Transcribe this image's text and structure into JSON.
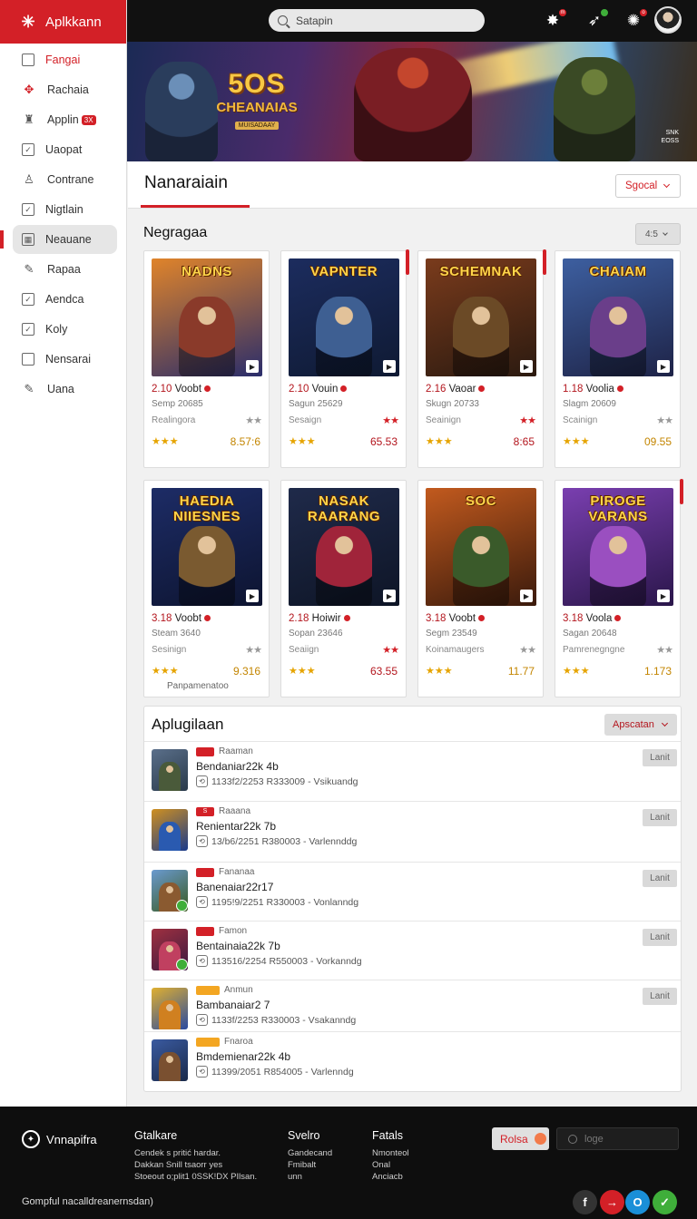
{
  "app": {
    "title": "Aplkkann"
  },
  "sidebar": {
    "items": [
      {
        "label": "Fangai",
        "icon": "square-icon",
        "active": false
      },
      {
        "label": "Rachaia",
        "icon": "gamepad-icon",
        "active": false
      },
      {
        "label": "Applin",
        "icon": "trophy-icon",
        "active": false,
        "badge": "3X"
      },
      {
        "label": "Uaopat",
        "icon": "checkbox-icon",
        "active": false
      },
      {
        "label": "Contrane",
        "icon": "user-icon",
        "active": false
      },
      {
        "label": "Nigtlain",
        "icon": "checkbox-icon",
        "active": false
      },
      {
        "label": "Neauane",
        "icon": "grid-icon",
        "active": true
      },
      {
        "label": "Rapaa",
        "icon": "pencil-icon",
        "active": false
      },
      {
        "label": "Aendca",
        "icon": "checkbox-icon",
        "active": false
      },
      {
        "label": "Koly",
        "icon": "checkbox-icon",
        "active": false
      },
      {
        "label": "Nensarai",
        "icon": "square-icon",
        "active": false
      },
      {
        "label": "Uana",
        "icon": "pencil-icon",
        "active": false
      }
    ]
  },
  "topbar": {
    "search_placeholder": "Satapin",
    "icons": [
      "puzzle-icon",
      "gamepad-icon",
      "bell-icon"
    ],
    "badges": [
      "m",
      "",
      "o"
    ]
  },
  "hero": {
    "title_top": "5OS",
    "title_main": "CHEANAIAS",
    "title_sub": "MUISADAAY",
    "tag_line1": "SNK",
    "tag_line2": "EOSS"
  },
  "page": {
    "title": "Nanaraiain",
    "select_label": "Sgocal"
  },
  "grid": {
    "title": "Negragaa",
    "select_label": "4:5",
    "cards": [
      {
        "thumb_title": "NADNS",
        "price_tag": "2.10",
        "name": "Voobt",
        "date": "Semp 20685",
        "label": "Realingora",
        "rating_marks": "★★",
        "stars": "★★★",
        "price": "8.57:6",
        "colors": [
          "#e0842a",
          "#2a2d6b"
        ],
        "figure": "#8a3a2a",
        "flag": false,
        "price_red": false
      },
      {
        "thumb_title": "VAPNTER",
        "price_tag": "2.10",
        "name": "Vouin",
        "date": "Sagun 25629",
        "label": "Sesaign",
        "rating_marks": "★★",
        "stars": "★★★",
        "price": "65.53",
        "colors": [
          "#1c2c5e",
          "#0f1a33"
        ],
        "figure": "#3e5f92",
        "flag": true,
        "price_red": true
      },
      {
        "thumb_title": "SCHEMNAK",
        "price_tag": "2.16",
        "name": "Vaoar",
        "date": "Skugn 20733",
        "label": "Seainign",
        "rating_marks": "★★",
        "stars": "★★★",
        "price": "8:65",
        "colors": [
          "#7a3b1c",
          "#2b1a10"
        ],
        "figure": "#6b4a26",
        "flag": true,
        "price_red": true
      },
      {
        "thumb_title": "CHAIAM",
        "price_tag": "1.18",
        "name": "Voolia",
        "date": "Slagm 20609",
        "label": "Scainign",
        "rating_marks": "★★",
        "stars": "★★★",
        "price": "09.55",
        "colors": [
          "#3d5fa0",
          "#1e2347"
        ],
        "figure": "#6a3e8a",
        "flag": false,
        "price_red": false
      },
      {
        "thumb_title": "HAEDIA NIIESNES",
        "price_tag": "3.18",
        "name": "Voobt",
        "date": "Steam 3640",
        "label": "Sesinign",
        "rating_marks": "★★",
        "stars": "★★★",
        "price": "9.316",
        "colors": [
          "#1d2c66",
          "#0d1430"
        ],
        "figure": "#7a5a30",
        "flag": false,
        "price_red": false,
        "caption": "Panpamenatoo"
      },
      {
        "thumb_title": "NASAK RAARANG",
        "price_tag": "2.18",
        "name": "Hoiwir",
        "date": "Sopan 23646",
        "label": "Seaiign",
        "rating_marks": "★★",
        "stars": "★★★",
        "price": "63.55",
        "colors": [
          "#1f2a4a",
          "#0e1526"
        ],
        "figure": "#a0243a",
        "flag": false,
        "price_red": true
      },
      {
        "thumb_title": "SOC",
        "price_tag": "3.18",
        "name": "Voobt",
        "date": "Segm 23549",
        "label": "Koinamaugers",
        "rating_marks": "★★",
        "stars": "★★★",
        "price": "11.77",
        "colors": [
          "#c25a1e",
          "#3a1a0c"
        ],
        "figure": "#3a5a2a",
        "flag": false,
        "price_red": false
      },
      {
        "thumb_title": "PIROGE VARANS",
        "price_tag": "3.18",
        "name": "Voola",
        "date": "Sagan 20648",
        "label": "Pamrenegngne",
        "rating_marks": "★★",
        "stars": "★★★",
        "price": "1.173",
        "colors": [
          "#7a3fb0",
          "#2a164a"
        ],
        "figure": "#9a4fc0",
        "flag": true,
        "price_red": false
      }
    ]
  },
  "list": {
    "title": "Aplugilaan",
    "select_label": "Apscatan",
    "rows": [
      {
        "tag_badge": "",
        "tag": "Raaman",
        "name": "Bendaniar22k 4b",
        "meta": "1133f2/2253 R333009 - Vsikuandg",
        "button": "Lanit",
        "colors": [
          "#5a6f8a",
          "#2a3a4a"
        ],
        "figure": "#4a5a3a",
        "badge_orange": false
      },
      {
        "tag_badge": "S",
        "tag": "Raaana",
        "name": "Renientar22k 7b",
        "meta": "13/b6/2251 R380003 - Varlennddg",
        "button": "Lanit",
        "colors": [
          "#d09020",
          "#1a3a8a"
        ],
        "figure": "#2a5ab0",
        "badge_orange": false
      },
      {
        "tag_badge": "",
        "tag": "Fananaa",
        "name": "Banenaiar22r17",
        "meta": "1195!9/2251 R330003 - Vonlanndg",
        "button": "Lanit",
        "colors": [
          "#6a9ad0",
          "#3a5a20"
        ],
        "figure": "#8a5a30",
        "badge_orange": false
      },
      {
        "tag_badge": "",
        "tag": "Famon",
        "name": "Bentainaia22k 7b",
        "meta": "113516/2254 R550003 - Vorkanndg",
        "button": "Lanit",
        "colors": [
          "#a03040",
          "#3a1a40"
        ],
        "figure": "#c04060",
        "badge_orange": false
      },
      {
        "tag_badge": "",
        "tag": "Anmun",
        "name": "Bambanaiar2 7",
        "meta": "1133f/2253 R330003 - Vsakanndg",
        "button": "Lanit",
        "colors": [
          "#e0b030",
          "#2a4aa0"
        ],
        "figure": "#d08020",
        "badge_orange": true
      },
      {
        "tag_badge": "",
        "tag": "Fnaroa",
        "name": "Bmdemienar22k 4b",
        "meta": "11399/2051 R854005 - Varlenndg",
        "button": "",
        "colors": [
          "#3a5aa0",
          "#1a2a4a"
        ],
        "figure": "#7a5030",
        "badge_orange": true
      }
    ]
  },
  "footer": {
    "logo_text": "Vnnapifra",
    "columns": [
      {
        "heading": "Gtalkare",
        "lines": [
          "Cendek s pritić hardar.",
          "Dakkan Snill tsaorr yes",
          "Stoeout o;plit1 0SSK!DX PIlsan."
        ]
      },
      {
        "heading": "Svelro",
        "lines": [
          "Gandecand",
          "Fmibalt",
          "unn"
        ]
      },
      {
        "heading": "Fatals",
        "lines": [
          "Nmonteol",
          "Onal",
          "Anciacb"
        ]
      }
    ],
    "button_label": "Rolsa",
    "search_placeholder": "loge",
    "copyright": "Gompful nacalldreanernsdan)",
    "social": [
      {
        "icon": "facebook-icon",
        "glyph": "f",
        "color": "#333333"
      },
      {
        "icon": "youtube-icon",
        "glyph": "→",
        "color": "#d32027"
      },
      {
        "icon": "twitter-icon",
        "glyph": "O",
        "color": "#1a8fd8"
      },
      {
        "icon": "whatsapp-icon",
        "glyph": "✓",
        "color": "#3fae3a"
      }
    ]
  },
  "colors": {
    "accent": "#d32027",
    "dark": "#111111",
    "star": "#e6a400"
  }
}
